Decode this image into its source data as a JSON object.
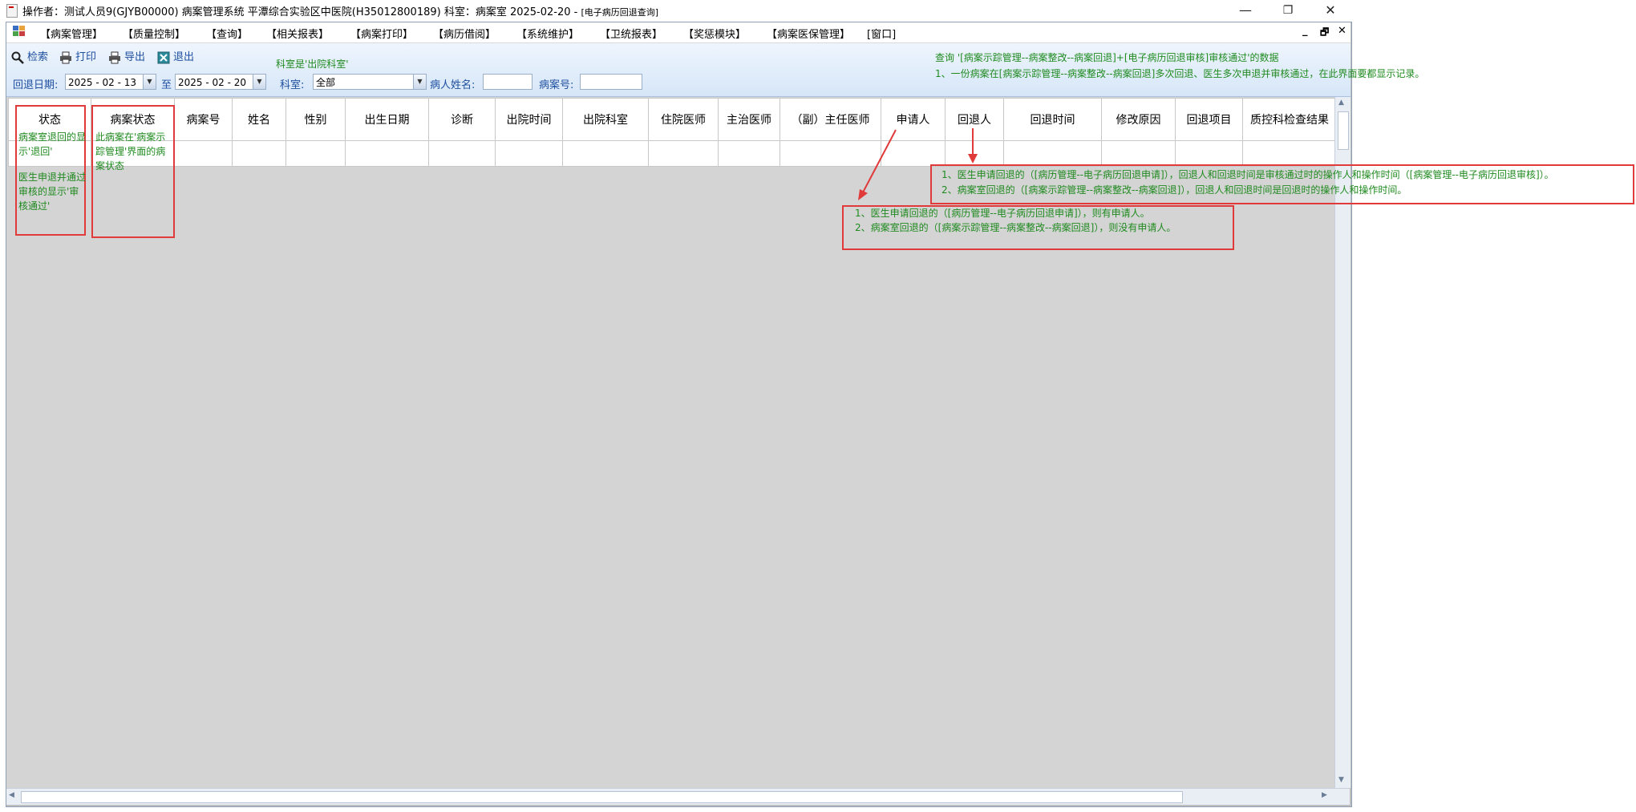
{
  "window": {
    "title": "操作者：测试人员9(GJYB00000) 病案管理系统  平潭综合实验区中医院(H35012800189)  科室：病案室 2025-02-20  - ",
    "subtitle": "[电子病历回退查询]",
    "minimize": "—",
    "restore": "❐",
    "close": "✕"
  },
  "menu": {
    "items": [
      "【病案管理】",
      "【质量控制】",
      "【查询】",
      "【相关报表】",
      "【病案打印】",
      "【病历借阅】",
      "【系统维护】",
      "【卫统报表】",
      "【奖惩模块】",
      "【病案医保管理】",
      "[窗口]"
    ],
    "mdi_minimize": "_",
    "mdi_restore": "🗗",
    "mdi_close": "✕"
  },
  "toolbar": {
    "search": "检索",
    "print": "打印",
    "export": "导出",
    "exit": "退出",
    "dept_note": "科室是'出院科室'",
    "query_note": "查询 '[病案示踪管理--病案整改--病案回退]+[电子病历回退审核]审核通过'的数据",
    "query_note2": "1、一份病案在[病案示踪管理--病案整改--病案回退]多次回退、医生多次申退并审核通过，在此界面要都显示记录。"
  },
  "filters": {
    "date_label": "回退日期:",
    "date_from": "2025 - 02 - 13",
    "to_label": "至",
    "date_to": "2025 - 02 - 20",
    "dept_label": "科室:",
    "dept_value": "全部",
    "patient_label": "病人姓名:",
    "patient_value": "",
    "record_label": "病案号:",
    "record_value": ""
  },
  "grid": {
    "columns": [
      "状态",
      "病案状态",
      "病案号",
      "姓名",
      "性别",
      "出生日期",
      "诊断",
      "出院时间",
      "出院科室",
      "住院医师",
      "主治医师",
      "（副）主任医师",
      "申请人",
      "回退人",
      "回退时间",
      "修改原因",
      "回退项目",
      "质控科检查结果"
    ]
  },
  "annotations": {
    "status_note1": "病案室退回的显示'退回'",
    "status_note2": "医生申退并通过审核的显示'审核通过'",
    "record_state_note": "此病案在'病案示踪管理'界面的病案状态",
    "applicant_note_1": "1、医生申请回退的（[病历管理--电子病历回退申请]），则有申请人。",
    "applicant_note_2": "2、病案室回退的（[病案示踪管理--病案整改--病案回退]），则没有申请人。",
    "returner_note_1": "1、医生申请回退的（[病历管理--电子病历回退申请]），回退人和回退时间是审核通过时的操作人和操作时间（[病案管理--电子病历回退审核]）。",
    "returner_note_2": "2、病案室回退的（[病案示踪管理--病案整改--病案回退]），回退人和回退时间是回退时的操作人和操作时间。"
  },
  "colors": {
    "annotation_green": "#1f8a1f",
    "annotation_red": "#e03a3a",
    "toolbar_text": "#1f4fa0"
  }
}
